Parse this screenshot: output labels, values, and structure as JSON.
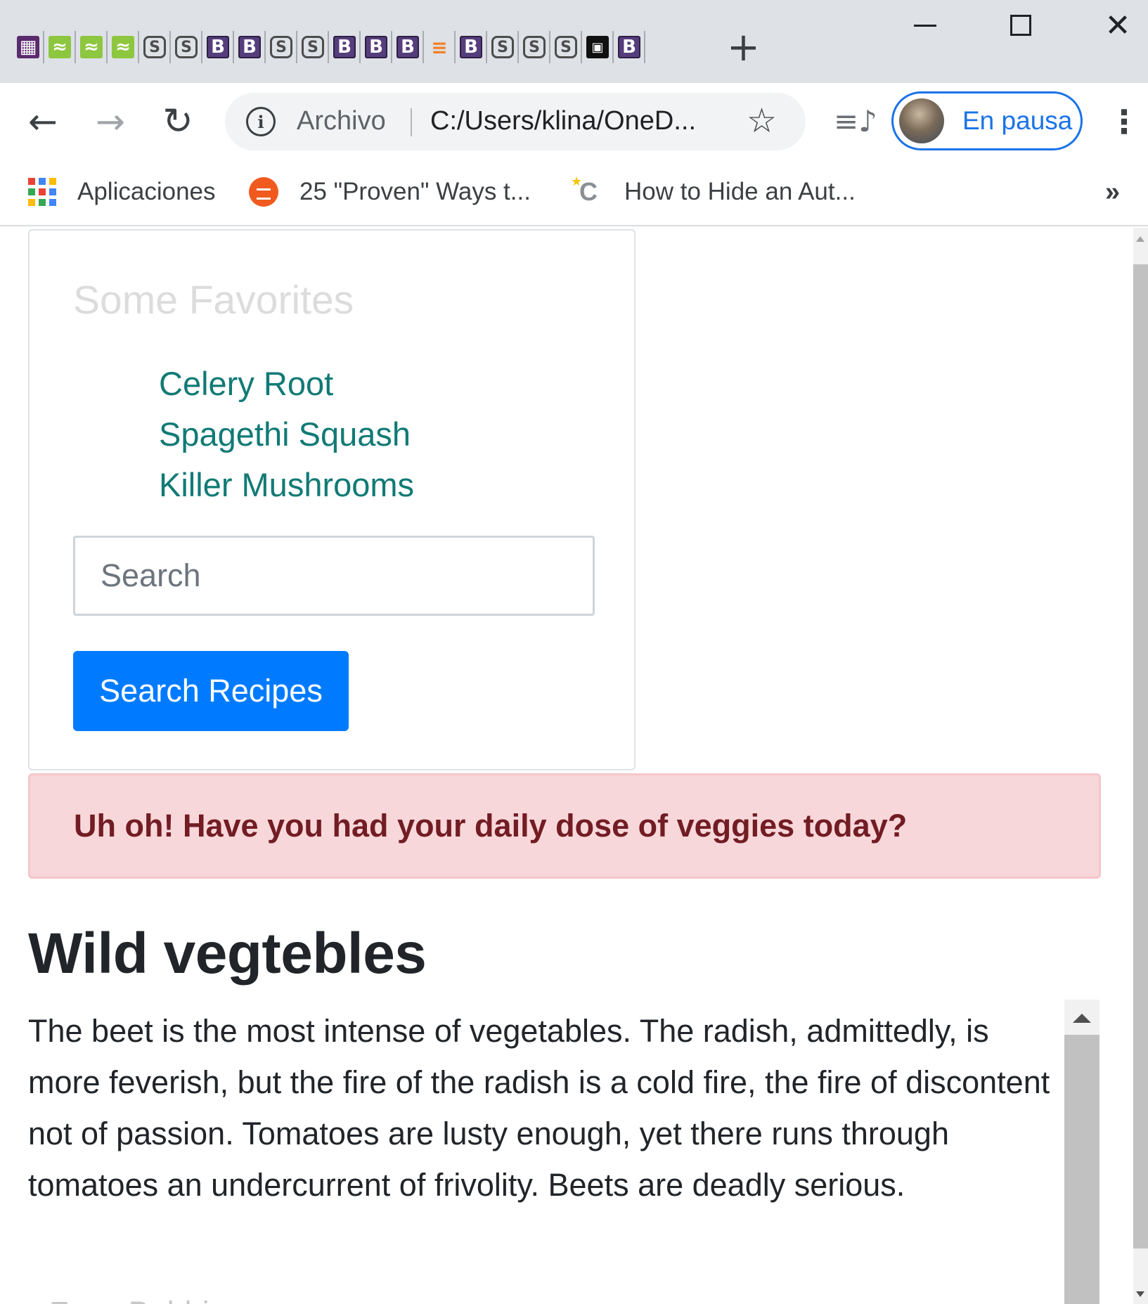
{
  "browser": {
    "tab_favicons": [
      {
        "icon": "maze-favicon-icon",
        "glyph": "▦",
        "style": "maze"
      },
      {
        "icon": "graph-favicon-icon",
        "glyph": "≈",
        "style": "graph"
      },
      {
        "icon": "graph-favicon-icon",
        "glyph": "≈",
        "style": "graph"
      },
      {
        "icon": "graph-favicon-icon",
        "glyph": "≈",
        "style": "graph"
      },
      {
        "icon": "s-favicon-icon",
        "glyph": "S",
        "style": "s"
      },
      {
        "icon": "s-favicon-icon",
        "glyph": "S",
        "style": "s"
      },
      {
        "icon": "bootstrap-favicon-icon",
        "glyph": "B",
        "style": "b"
      },
      {
        "icon": "bootstrap-favicon-icon",
        "glyph": "B",
        "style": "b"
      },
      {
        "icon": "s-favicon-icon",
        "glyph": "S",
        "style": "s"
      },
      {
        "icon": "s-favicon-icon",
        "glyph": "S",
        "style": "s"
      },
      {
        "icon": "bootstrap-favicon-icon",
        "glyph": "B",
        "style": "b"
      },
      {
        "icon": "bootstrap-favicon-icon",
        "glyph": "B",
        "style": "b"
      },
      {
        "icon": "bootstrap-favicon-icon",
        "glyph": "B",
        "style": "b"
      },
      {
        "icon": "stackoverflow-favicon-icon",
        "glyph": "≡",
        "style": "so"
      },
      {
        "icon": "bootstrap-favicon-icon",
        "glyph": "B",
        "style": "b"
      },
      {
        "icon": "s-favicon-icon",
        "glyph": "S",
        "style": "s"
      },
      {
        "icon": "s-favicon-icon",
        "glyph": "S",
        "style": "s"
      },
      {
        "icon": "s-favicon-icon",
        "glyph": "S",
        "style": "s"
      },
      {
        "icon": "book-favicon-icon",
        "glyph": "▣",
        "style": "book"
      },
      {
        "icon": "bootstrap-favicon-icon",
        "glyph": "B",
        "style": "b"
      }
    ],
    "new_tab_glyph": "+",
    "window_controls": {
      "close_glyph": "✕"
    },
    "toolbar": {
      "back_glyph": "←",
      "forward_glyph": "→",
      "reload_glyph": "↻",
      "info_glyph": "i",
      "scheme_label": "Archivo",
      "url": "C:/Users/klina/OneD...",
      "star_glyph": "☆",
      "media_glyph": "≡♪",
      "profile_status": "En pausa",
      "menu_glyph": "⋮"
    },
    "bookmarks": {
      "apps_label": "Aplicaciones",
      "items": [
        {
          "label": "25 \"Proven\" Ways t...",
          "icon": "hotjar-icon"
        },
        {
          "label": "How to Hide an Aut...",
          "icon": "c-star-icon",
          "glyph": "C"
        }
      ],
      "more_glyph": "»"
    },
    "colors": {
      "accent": "#1a73e8",
      "tabstrip": "#dee1e6"
    }
  },
  "page": {
    "card": {
      "title": "Some Favorites",
      "favorites": [
        "Celery Root",
        "Spagethi Squash",
        "Killer Mushrooms"
      ],
      "search_placeholder": "Search",
      "search_button": "Search Recipes"
    },
    "alert": {
      "text": "Uh oh! Have you had your daily dose of veggies today?"
    },
    "article": {
      "heading": "Wild vegtebles",
      "paragraph": "The beet is the most intense of vegetables. The radish, admittedly, is more feverish, but the fire of the radish is a cold fire, the fire of discontent not of passion. Tomatoes are lusty enough, yet there runs through tomatoes an undercurrent of frivolity. Beets are deadly serious.",
      "next_item_partial": "Fava Bubbi..."
    },
    "colors": {
      "link": "#117a75",
      "button": "#007bff",
      "alert_bg": "#f8d7da",
      "alert_text": "#721c24",
      "text": "#212529"
    }
  }
}
